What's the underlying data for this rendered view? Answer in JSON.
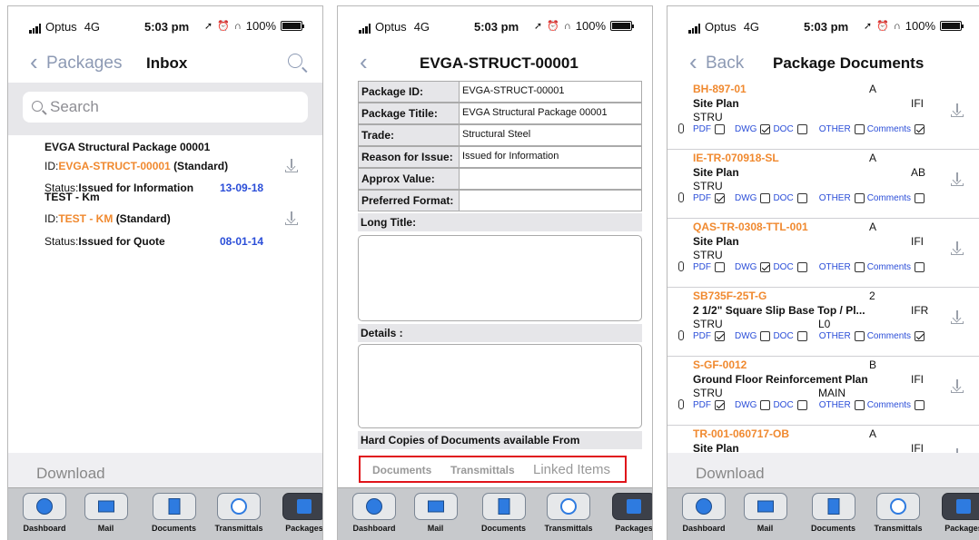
{
  "status": {
    "carrier": "Optus",
    "network": "4G",
    "time": "5:03 pm",
    "battery": "100%"
  },
  "screen1": {
    "nav": {
      "back_label": "Packages",
      "title": "Inbox"
    },
    "search_placeholder": "Search",
    "packages": [
      {
        "title": "EVGA Structural Package 00001",
        "id_label": "ID:",
        "id_code": "EVGA-STRUCT-00001",
        "id_type": "(Standard)",
        "status_label": "Status:",
        "status": "Issued for Information",
        "date": "13-09-18"
      },
      {
        "title": "TEST - Km",
        "id_label": "ID:",
        "id_code": "TEST - KM",
        "id_type": "(Standard)",
        "status_label": "Status:",
        "status": "Issued for Quote",
        "date": "08-01-14"
      }
    ],
    "download_label": "Download"
  },
  "screen2": {
    "nav": {
      "title": "EVGA-STRUCT-00001"
    },
    "fields": [
      {
        "label": "Package ID:",
        "value": "EVGA-STRUCT-00001"
      },
      {
        "label": "Package Titile:",
        "value": "EVGA Structural Package 00001"
      },
      {
        "label": "Trade:",
        "value": "Structural Steel"
      },
      {
        "label": "Reason for Issue:",
        "value": "Issued for Information"
      },
      {
        "label": "Approx Value:",
        "value": ""
      },
      {
        "label": "Preferred Format:",
        "value": ""
      }
    ],
    "long_title_label": "Long Title:",
    "details_label": "Details :",
    "hard_copies_label": "Hard Copies of Documents available From",
    "segments": [
      "Documents",
      "Transmittals",
      "Linked Items"
    ]
  },
  "screen3": {
    "nav": {
      "back_label": "Back",
      "title": "Package Documents"
    },
    "flag_labels": {
      "pdf": "PDF",
      "dwg": "DWG",
      "doc": "DOC",
      "other": "OTHER",
      "comments": "Comments"
    },
    "documents": [
      {
        "code": "BH-897-01",
        "rev": "A",
        "name": "Site Plan",
        "discipline": "STRU",
        "extra": "",
        "status": "IFI",
        "pdf": false,
        "dwg": true,
        "doc": false,
        "other": false,
        "comments": true
      },
      {
        "code": "IE-TR-070918-SL",
        "rev": "A",
        "name": "Site Plan",
        "discipline": "STRU",
        "extra": "",
        "status": "AB",
        "pdf": true,
        "dwg": false,
        "doc": false,
        "other": false,
        "comments": false
      },
      {
        "code": "QAS-TR-0308-TTL-001",
        "rev": "A",
        "name": "Site Plan",
        "discipline": "STRU",
        "extra": "",
        "status": "IFI",
        "pdf": false,
        "dwg": true,
        "doc": false,
        "other": false,
        "comments": false
      },
      {
        "code": "SB735F-25T-G",
        "rev": "2",
        "name": "2 1/2\" Square Slip Base Top / Pl...",
        "discipline": "STRU",
        "extra": "L0",
        "status": "IFR",
        "pdf": true,
        "dwg": false,
        "doc": false,
        "other": false,
        "comments": true
      },
      {
        "code": "S-GF-0012",
        "rev": "B",
        "name": "Ground Floor Reinforcement Plan",
        "discipline": "STRU",
        "extra": "MAIN",
        "status": "IFI",
        "pdf": true,
        "dwg": false,
        "doc": false,
        "other": false,
        "comments": false
      },
      {
        "code": "TR-001-060717-OB",
        "rev": "A",
        "name": "Site Plan",
        "discipline": "",
        "extra": "",
        "status": "IFI",
        "pdf": false,
        "dwg": false,
        "doc": false,
        "other": false,
        "comments": false
      }
    ],
    "download_label": "Download"
  },
  "tabbar": {
    "tabs": [
      {
        "label": "Dashboard",
        "icon": "dashboard-icon"
      },
      {
        "label": "Mail",
        "icon": "mail-icon"
      },
      {
        "label": "Documents",
        "icon": "documents-icon"
      },
      {
        "label": "Transmittals",
        "icon": "transmittals-icon"
      },
      {
        "label": "Packages",
        "icon": "packages-icon"
      }
    ]
  },
  "colors": {
    "accent_orange": "#f0892f",
    "date_blue": "#2b4ed8",
    "nav_gray": "#8d9ab4",
    "highlight_red": "#e0141a"
  }
}
